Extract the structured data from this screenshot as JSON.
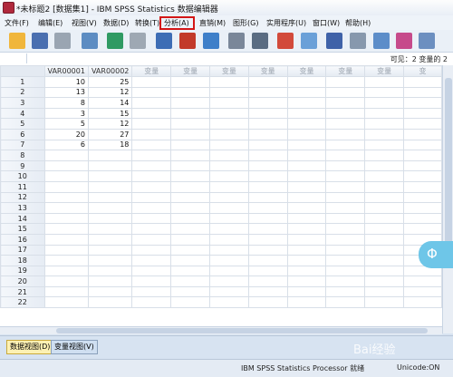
{
  "window": {
    "title": "*未标题2 [数据集1] - IBM SPSS Statistics 数据编辑器"
  },
  "menu": [
    "文件(F)",
    "编辑(E)",
    "视图(V)",
    "数据(D)",
    "转换(T)",
    "分析(A)",
    "直销(M)",
    "图形(G)",
    "实用程序(U)",
    "窗口(W)",
    "帮助(H)"
  ],
  "toolbar": [
    "open-icon",
    "save-icon",
    "print-icon",
    "dialog-recall-icon",
    "undo-icon",
    "redo-icon",
    "goto-case-icon",
    "goto-variable-icon",
    "variables-icon",
    "find-icon",
    "insert-cases-icon",
    "insert-variable-icon",
    "split-file-icon",
    "weight-cases-icon",
    "select-cases-icon",
    "value-labels-icon",
    "use-sets-icon",
    "show-all-icon"
  ],
  "visible": "可见：2 变量的 2",
  "columns": [
    "VAR00001",
    "VAR00002",
    "变量",
    "变量",
    "变量",
    "变量",
    "变量",
    "变量",
    "变量",
    "变"
  ],
  "rows": [
    {
      "n": "1",
      "v1": "10",
      "v2": "25"
    },
    {
      "n": "2",
      "v1": "13",
      "v2": "12"
    },
    {
      "n": "3",
      "v1": "8",
      "v2": "14"
    },
    {
      "n": "4",
      "v1": "3",
      "v2": "15"
    },
    {
      "n": "5",
      "v1": "5",
      "v2": "12"
    },
    {
      "n": "6",
      "v1": "20",
      "v2": "27"
    },
    {
      "n": "7",
      "v1": "6",
      "v2": "18"
    },
    {
      "n": "8",
      "v1": "",
      "v2": ""
    },
    {
      "n": "9",
      "v1": "",
      "v2": ""
    },
    {
      "n": "10",
      "v1": "",
      "v2": ""
    },
    {
      "n": "11",
      "v1": "",
      "v2": ""
    },
    {
      "n": "12",
      "v1": "",
      "v2": ""
    },
    {
      "n": "13",
      "v1": "",
      "v2": ""
    },
    {
      "n": "14",
      "v1": "",
      "v2": ""
    },
    {
      "n": "15",
      "v1": "",
      "v2": ""
    },
    {
      "n": "16",
      "v1": "",
      "v2": ""
    },
    {
      "n": "17",
      "v1": "",
      "v2": ""
    },
    {
      "n": "18",
      "v1": "",
      "v2": ""
    },
    {
      "n": "19",
      "v1": "",
      "v2": ""
    },
    {
      "n": "20",
      "v1": "",
      "v2": ""
    },
    {
      "n": "21",
      "v1": "",
      "v2": ""
    },
    {
      "n": "22",
      "v1": "",
      "v2": ""
    }
  ],
  "tabs": {
    "data_view": "数据视图(D)",
    "variable_view": "变量视图(V)"
  },
  "status": {
    "processor": "IBM SPSS Statistics Processor 就绪",
    "unicode": "Unicode:ON"
  },
  "watermark": "Bai经验",
  "colors": {
    "highlight": "#d31616",
    "active_tab": "#fdf1b3",
    "float_button": "#6ec6e8"
  }
}
